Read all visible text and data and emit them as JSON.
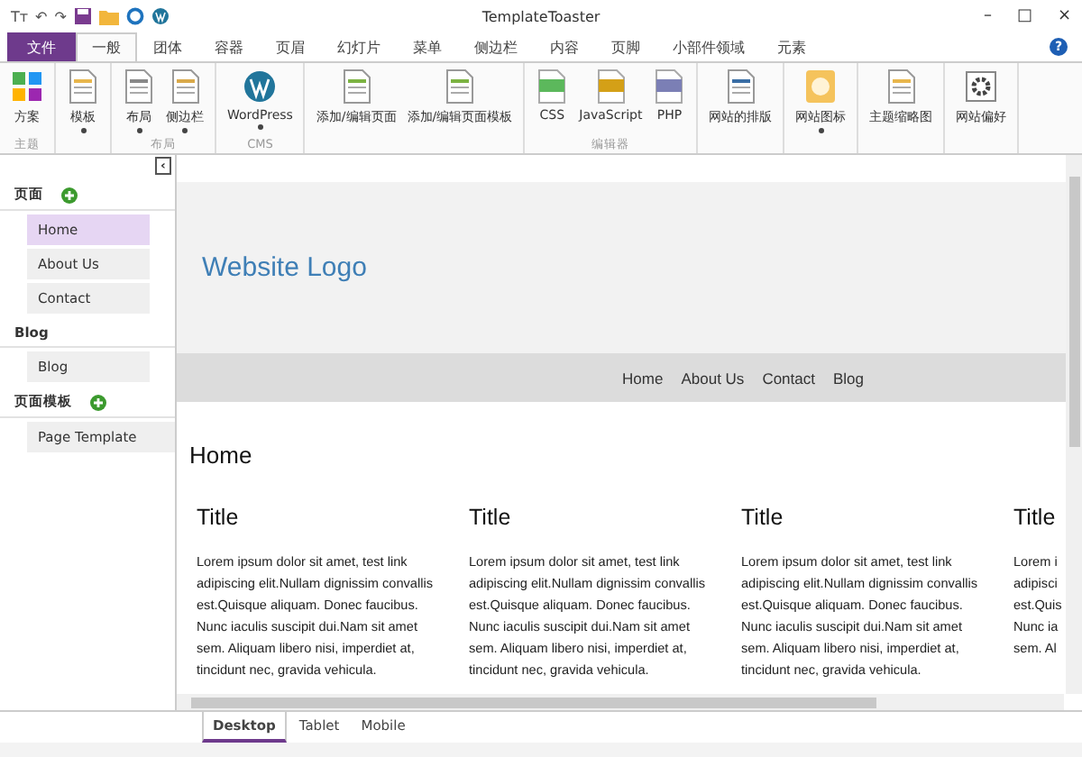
{
  "window": {
    "title": "TemplateToaster",
    "controls": [
      "–",
      "□",
      "×"
    ]
  },
  "quick_access": [
    "Tт",
    "↶",
    "↷"
  ],
  "menu_tabs": [
    {
      "label": "文件",
      "kind": "file",
      "selected": false
    },
    {
      "label": "一般",
      "kind": "tab",
      "selected": true
    },
    {
      "label": "团体",
      "kind": "tab",
      "selected": false
    },
    {
      "label": "容器",
      "kind": "tab",
      "selected": false
    },
    {
      "label": "页眉",
      "kind": "tab",
      "selected": false
    },
    {
      "label": "幻灯片",
      "kind": "tab",
      "selected": false
    },
    {
      "label": "菜单",
      "kind": "tab",
      "selected": false
    },
    {
      "label": "侧边栏",
      "kind": "tab",
      "selected": false
    },
    {
      "label": "内容",
      "kind": "tab",
      "selected": false
    },
    {
      "label": "页脚",
      "kind": "tab",
      "selected": false
    },
    {
      "label": "小部件领域",
      "kind": "tab",
      "selected": false
    },
    {
      "label": "元素",
      "kind": "tab",
      "selected": false
    }
  ],
  "help": "?",
  "ribbon_groups": [
    {
      "label": "主题",
      "buttons": [
        {
          "label": "方案",
          "dropdown": false
        }
      ]
    },
    {
      "buttons": [
        {
          "label": "模板",
          "dropdown": true
        }
      ]
    },
    {
      "label": "布局",
      "buttons": [
        {
          "label": "布局",
          "dropdown": true
        },
        {
          "label": "侧边栏",
          "dropdown": true
        }
      ]
    },
    {
      "label": "CMS",
      "buttons": [
        {
          "label": "WordPress",
          "dropdown": true
        }
      ]
    },
    {
      "buttons": [
        {
          "label": "添加/编辑页面",
          "dropdown": false
        },
        {
          "label": "添加/编辑页面模板",
          "dropdown": false
        }
      ]
    },
    {
      "label": "编辑器",
      "buttons": [
        {
          "label": "CSS",
          "dropdown": false
        },
        {
          "label": "JavaScript",
          "dropdown": false
        },
        {
          "label": "PHP",
          "dropdown": false
        }
      ]
    },
    {
      "buttons": [
        {
          "label": "网站的排版",
          "dropdown": false
        }
      ]
    },
    {
      "buttons": [
        {
          "label": "网站图标",
          "dropdown": true
        }
      ]
    },
    {
      "buttons": [
        {
          "label": "主题缩略图",
          "dropdown": false
        }
      ]
    },
    {
      "buttons": [
        {
          "label": "网站偏好",
          "dropdown": false
        }
      ]
    }
  ],
  "sidebar": {
    "collapse": "‹",
    "sections": [
      {
        "title": "页面",
        "addable": true,
        "items": [
          {
            "label": "Home",
            "selected": true
          },
          {
            "label": "About Us",
            "selected": false
          },
          {
            "label": "Contact",
            "selected": false
          }
        ]
      },
      {
        "title": "Blog",
        "addable": false,
        "items": [
          {
            "label": "Blog",
            "selected": false
          }
        ]
      },
      {
        "title": "页面模板",
        "addable": true,
        "items": [
          {
            "label": "Page Template",
            "selected": false
          }
        ]
      }
    ]
  },
  "preview": {
    "logo": "Website Logo",
    "nav": [
      "Home",
      "About Us",
      "Contact",
      "Blog"
    ],
    "heading": "Home",
    "columns": [
      {
        "title": "Title",
        "lines": [
          "Lorem ipsum dolor sit amet, test link",
          "adipiscing elit.Nullam dignissim convallis",
          "est.Quisque aliquam. Donec faucibus.",
          "Nunc iaculis suscipit dui.Nam sit amet",
          "sem. Aliquam libero nisi, imperdiet at,",
          "tincidunt nec, gravida vehicula."
        ]
      },
      {
        "title": "Title",
        "lines": [
          "Lorem ipsum dolor sit amet, test link",
          "adipiscing elit.Nullam dignissim convallis",
          "est.Quisque aliquam. Donec faucibus.",
          "Nunc iaculis suscipit dui.Nam sit amet",
          "sem. Aliquam libero nisi, imperdiet at,",
          "tincidunt nec, gravida vehicula."
        ]
      },
      {
        "title": "Title",
        "lines": [
          "Lorem ipsum dolor sit amet, test link",
          "adipiscing elit.Nullam dignissim convallis",
          "est.Quisque aliquam. Donec faucibus.",
          "Nunc iaculis suscipit dui.Nam sit amet",
          "sem. Aliquam libero nisi, imperdiet at,",
          "tincidunt nec, gravida vehicula."
        ]
      },
      {
        "title": "Title",
        "lines": [
          "Lorem i",
          "adipisci",
          "est.Quis",
          "Nunc ia",
          "sem. Al"
        ]
      }
    ]
  },
  "view_tabs": [
    {
      "label": "Desktop",
      "selected": true
    },
    {
      "label": "Tablet",
      "selected": false
    },
    {
      "label": "Mobile",
      "selected": false
    }
  ]
}
